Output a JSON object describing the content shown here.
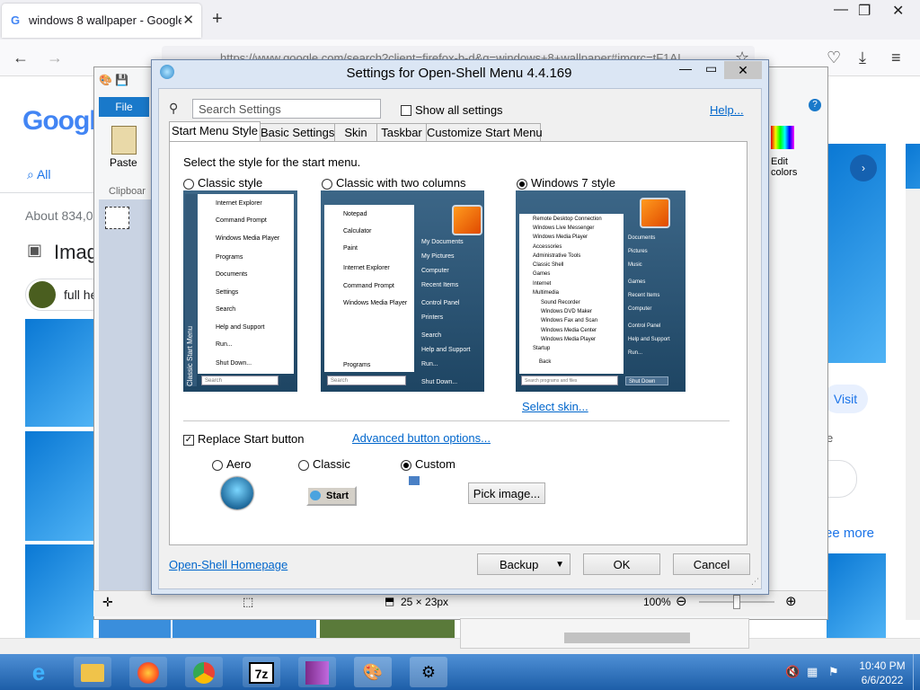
{
  "browser": {
    "tab_title": "windows 8 wallpaper - Google S",
    "new_tab": "+",
    "url": "https://www.google.com/search?client=firefox-b-d&q=windows+8+wallpaper#imgrc=tF1AI",
    "min": "—",
    "max": "❐",
    "close": "✕"
  },
  "google": {
    "logo": "Googl",
    "all_tab": "All",
    "about": "About 834,0",
    "images_heading": "Imag",
    "chip": "full he",
    "visit": "Visit",
    "e_text": "e",
    "see_more": "ee more"
  },
  "paint": {
    "file_tab": "File",
    "paste": "Paste",
    "clipboard": "Clipboar",
    "edit_colors": "Edit colors",
    "size": "25 × 23px",
    "zoom": "100%"
  },
  "dialog": {
    "title": "Settings for Open-Shell Menu 4.4.169",
    "search_placeholder": "Search Settings",
    "show_all": "Show all settings",
    "help": "Help...",
    "tabs": [
      "Start Menu Style",
      "Basic Settings",
      "Skin",
      "Taskbar",
      "Customize Start Menu"
    ],
    "prompt": "Select the style for the start menu.",
    "styles": [
      "Classic style",
      "Classic with two columns",
      "Windows 7 style"
    ],
    "select_skin": "Select skin...",
    "replace_start": "Replace Start button",
    "advanced": "Advanced button options...",
    "button_styles": [
      "Aero",
      "Classic",
      "Custom"
    ],
    "start_btn": "Start",
    "pick_image": "Pick image...",
    "homepage": "Open-Shell Homepage",
    "backup": "Backup",
    "ok": "OK",
    "cancel": "Cancel",
    "classic_items": [
      "Internet Explorer",
      "Command Prompt",
      "Windows Media Player",
      "Programs",
      "Documents",
      "Settings",
      "Search",
      "Help and Support",
      "Run...",
      "Shut Down..."
    ],
    "classic_vert": "Classic Start Menu",
    "classic_search": "Search",
    "two_left": [
      "Notepad",
      "Calculator",
      "Paint",
      "Internet Explorer",
      "Command Prompt",
      "Windows Media Player"
    ],
    "two_left_programs": "Programs",
    "two_right": [
      "My Documents",
      "My Pictures",
      "Computer",
      "Recent Items",
      "Control Panel",
      "Printers",
      "Search",
      "Help and Support",
      "Run...",
      "Shut Down..."
    ],
    "two_search": "Search",
    "w7_left": [
      "Remote Desktop Connection",
      "Windows Live Messenger",
      "Windows Media Player",
      "Accessories",
      "Administrative Tools",
      "Classic Shell",
      "Games",
      "Internet",
      "Multimedia",
      "Sound Recorder",
      "Windows DVD Maker",
      "Windows Fax and Scan",
      "Windows Media Center",
      "Windows Media Player",
      "Startup"
    ],
    "w7_back": "Back",
    "w7_search": "Search programs and files",
    "w7_right": [
      "Documents",
      "Pictures",
      "Music",
      "Games",
      "Recent Items",
      "Computer",
      "Control Panel",
      "Help and Support",
      "Run..."
    ],
    "w7_shutdown": "Shut Down"
  },
  "taskbar": {
    "time": "10:40 PM",
    "date": "6/6/2022",
    "icons": [
      "ie-icon",
      "explorer-icon",
      "firefox-icon",
      "chrome-icon",
      "7zip-icon",
      "winrar-icon",
      "paint-icon",
      "open-shell-icon"
    ],
    "zip_label": "7z"
  }
}
